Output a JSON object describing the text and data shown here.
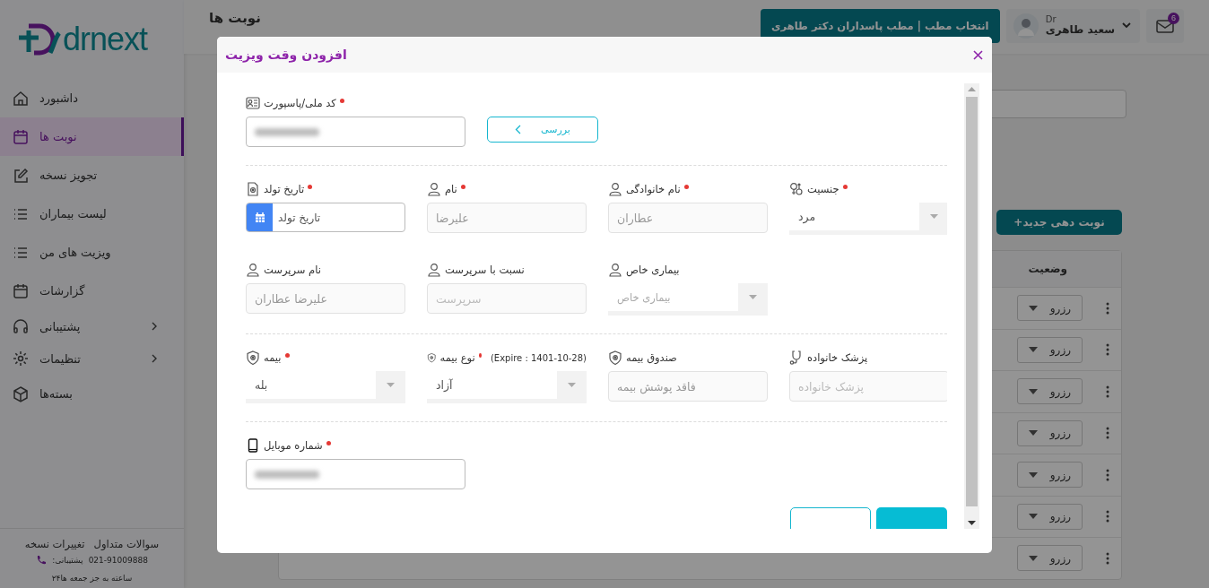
{
  "logo": {
    "text": "drnext"
  },
  "sidebar": {
    "items": [
      {
        "label": "داشبورد",
        "selected": false,
        "has_submenu": false
      },
      {
        "label": "نوبت ها",
        "selected": true,
        "has_submenu": false
      },
      {
        "label": "تجویز نسخه",
        "selected": false,
        "has_submenu": false
      },
      {
        "label": "لیست بیماران",
        "selected": false,
        "has_submenu": false
      },
      {
        "label": "ویزیت های من",
        "selected": false,
        "has_submenu": false
      },
      {
        "label": "گزارشات",
        "selected": false,
        "has_submenu": false
      },
      {
        "label": "پشتیبانی",
        "selected": false,
        "has_submenu": true
      },
      {
        "label": "تنظیمات",
        "selected": false,
        "has_submenu": true
      },
      {
        "label": "بسته‌ها",
        "selected": false,
        "has_submenu": false
      }
    ],
    "footer": {
      "links": [
        "سوالات متداول",
        "تغییرات نسخه"
      ],
      "phone": "021-91009888",
      "phone_label": ":پشتیبانی",
      "hours": "۲۴ساعته به جز جمعه ها"
    }
  },
  "header": {
    "title": "نوبت ها",
    "clinic_button": "انتخاب مطب | مطب پاسداران دکتر طاهری",
    "user": {
      "prefix": "Dr",
      "name": "سعید طاهری"
    },
    "mail_badge": "6"
  },
  "page": {
    "new_button": "+نوبت دهی جدید",
    "table": {
      "columns": [
        "وضعیت"
      ],
      "rows": [
        {
          "status": "رزرو"
        },
        {
          "status": "رزرو"
        },
        {
          "status": "رزرو"
        },
        {
          "status": "رزرو"
        },
        {
          "status": "رزرو"
        },
        {
          "status": "رزرو"
        },
        {
          "status": "رزرو"
        }
      ]
    }
  },
  "modal": {
    "title": "افزودن وقت ویزیت",
    "sections": [
      {
        "kind": "id",
        "rows": [
          [
            {
              "kind": "button",
              "label": "بررسی"
            },
            {
              "kind": "text",
              "label": "کد ملی/پاسپورت",
              "required": true,
              "masked": true,
              "disabled": false
            }
          ]
        ]
      },
      {
        "kind": "grid",
        "rows": [
          [
            {
              "kind": "select",
              "label": "جنسیت",
              "required": true,
              "value": "مرد"
            },
            {
              "kind": "text",
              "label": "نام خانوادگی",
              "required": true,
              "value": "عطاران",
              "disabled": true
            },
            {
              "kind": "text",
              "label": "نام",
              "required": true,
              "value": "علیرضا",
              "disabled": true
            },
            {
              "kind": "date",
              "label": "تاریخ تولد",
              "required": true,
              "placeholder": "تاریخ تولد",
              "disabled": false
            }
          ],
          [
            "",
            {
              "kind": "select",
              "label": "بیماری خاص",
              "required": false,
              "placeholder": "بیماری خاص"
            },
            {
              "kind": "text",
              "label": "نسبت با سرپرست",
              "required": false,
              "placeholder": "سرپرست",
              "disabled": true
            },
            {
              "kind": "text",
              "label": "نام سرپرست",
              "required": false,
              "value": "علیرضا عطاران",
              "disabled": true
            }
          ]
        ]
      },
      {
        "kind": "grid",
        "rows": [
          [
            {
              "kind": "text",
              "label": "پزشک خانواده",
              "required": false,
              "placeholder": "پزشک خانواده",
              "disabled": true
            },
            {
              "kind": "text",
              "label": "صندوق بیمه",
              "required": false,
              "value": "فاقد پوشش بیمه",
              "disabled": true
            },
            {
              "kind": "select",
              "label": "نوع بیمه",
              "required": true,
              "note": "(Expire : 1401-10-28)",
              "value": "آزاد"
            },
            {
              "kind": "select",
              "label": "بیمه",
              "required": true,
              "value": "بله"
            }
          ]
        ]
      },
      {
        "kind": "id",
        "rows": [
          [
            {
              "kind": "text",
              "label": "شماره موبایل",
              "required": true,
              "masked": true,
              "disabled": false
            }
          ]
        ]
      }
    ]
  }
}
